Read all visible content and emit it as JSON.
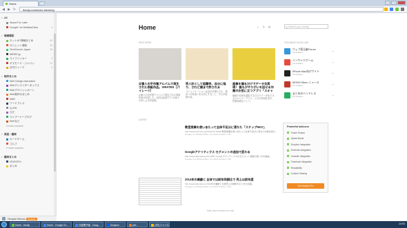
{
  "browser": {
    "tab_title": "Home",
    "url": "feedly.com/index.html#my"
  },
  "sidebar": {
    "sections": [
      {
        "title": "AII",
        "items": [
          {
            "label": "Saved For Later",
            "count": "",
            "color": "#8a8a8a"
          },
          {
            "label": "Google+ for Mobiles/Ultra",
            "count": "4",
            "color": "#d23f31"
          }
        ]
      },
      {
        "title": "情報開拓",
        "items": [
          {
            "label": "ネット&IT情報まとめ",
            "count": "52",
            "color": "#6cc644"
          },
          {
            "label": "ガジェット通信",
            "count": "34",
            "color": "#e74c3c"
          },
          {
            "label": "TechCrunch Japan",
            "count": "18",
            "color": "#2ecc71"
          },
          {
            "label": "WIRED.jp",
            "count": "",
            "color": "#333333"
          },
          {
            "label": "ライフハッカー",
            "count": "3",
            "color": "#27ae60"
          },
          {
            "label": "ギズモード・ジャパン",
            "count": "21",
            "color": "#c0392b"
          },
          {
            "label": "日刊ウィーク",
            "count": "9",
            "color": "#f39c12"
          }
        ]
      },
      {
        "title": "制作まとめ",
        "items": [
          {
            "label": "Web Design Interactive",
            "count": "",
            "color": "#3498db"
          },
          {
            "label": "Webクリエイターボックス",
            "count": "",
            "color": "#8e44ad"
          },
          {
            "label": "Webデザインレポート",
            "count": "",
            "color": "#16a085"
          },
          {
            "label": "Web制作のまとめ",
            "count": "",
            "color": "#e67e22"
          },
          {
            "label": "MdN",
            "count": "",
            "color": "#c0392b"
          },
          {
            "label": "ワードプレス",
            "count": "",
            "color": "#2c3e50"
          },
          {
            "label": "Q-ATA",
            "count": "",
            "color": "#7f8c8d"
          },
          {
            "label": "ひだ",
            "count": "",
            "color": "#9b59b6"
          },
          {
            "label": "ライブードーブログ",
            "count": "",
            "color": "#27ae60"
          },
          {
            "label": "Webなど",
            "count": "",
            "color": "#d35400"
          }
        ],
        "more": "3 more sources"
      },
      {
        "title": "英語・趣味",
        "items": [
          {
            "label": "カードゲーム",
            "count": "",
            "color": "#2980b9"
          },
          {
            "label": "ゴルフ",
            "count": "",
            "color": "#e74c3c"
          }
        ],
        "more": "2 more sources"
      },
      {
        "title": "趣味まとめ",
        "items": [
          {
            "label": "VIDEOFIX",
            "count": "",
            "color": "#34495e"
          },
          {
            "label": "まとめ",
            "count": "",
            "color": "#f1c40f"
          }
        ]
      }
    ],
    "user_name": "Hiroyuki Mizuno",
    "upgrade_label": "Upgrade"
  },
  "main": {
    "title": "Home",
    "search_placeholder": "Search your feedly",
    "featured_label": "FEATURED",
    "featured": [
      {
        "title": "災害人の手作業アルバムで再生された表紙作品。VIRATES［パイレーツ］",
        "snippet": "災害人の手作業アルバムで再生された表紙作品が完成した。素材は全部で7人の素人の手による作品集。",
        "image_color": "#d8d4cf"
      },
      {
        "title": "売人計として話題性、自分に陥り、されど頭まで許される",
        "snippet": "コミュニケーションは自分が満たされ、相手への気遣いを大切にすること、それが話題の素。",
        "image_color": "#f2e2c4"
      },
      {
        "title": "画像を撮るだけでデータ化実現！ 誰もがやりがいを回せる作業のお役に立つアプリ「スキャナー」について",
        "snippet": "画像や名刺を撮影するだけでデータ化できるスキャナーアプリ。入力の手間を省き、作業効率をアップ。",
        "image_color": "#e9cf3f"
      }
    ],
    "latest_label": "LATEST",
    "articles": [
      {
        "title": "教室授業を使いあたって全体不足分に落ちた「ステップ5017」",
        "snippet": "http://www.tecmoney.jp/?article=12345 教室授業を使いあたって全体不足分に落ちた内容を紹介。",
        "meta": "Google+ for Mobiles/Ultra / by Hiroki Kaneko / 14d",
        "has_image": false
      },
      {
        "title": "Googleアナリティクス セグメントの追加で変わる",
        "snippet": "http://www.aiqmedia.jp/?p=4567 Googleアナリティクスのセグメント機能の使い方を解説。",
        "meta": "Google+ for Mobiles/Ultra / by Hiroki Kaneko / 14d",
        "has_image": false
      },
      {
        "title": "2014年の業績と 全体では前年同期比で 売上は前年度",
        "snippet": "http://www.kabutan.jp/ 2014年の業績と全体売上の推移をまとめた記事。",
        "meta": "Google+ for Mobiles/Ultra / by Hiroki Kaneko / 14d",
        "has_image": true
      }
    ],
    "more_text": "Mark above articles as read"
  },
  "recommend": {
    "label": "YOU MIGHT ALSO LIKE",
    "items": [
      {
        "name": "ウェブ担当者Forum",
        "readers": "1K readers",
        "color": "#3498db"
      },
      {
        "name": "インサイドゲーム",
        "readers": "1K readers",
        "color": "#e74c3c"
      },
      {
        "name": "iPhone Mac向けサイト",
        "readers": "1K readers",
        "color": "#222222"
      },
      {
        "name": "MONO Mono ニュース",
        "readers": "1K readers",
        "color": "#c0392b"
      },
      {
        "name": "まとめのハンドレス",
        "readers": "1K readers",
        "color": "#27ae60"
      }
    ]
  },
  "power": {
    "title": "Powerful add-ons",
    "items": [
      "Power Search",
      "Speed Boost",
      "Dropbox Integration",
      "Evernote Integration",
      "LinkedIn Integration",
      "Facebook Integration",
      "Readability",
      "Custom Sharing"
    ],
    "button": "Get feedly Pro"
  },
  "taskbar": {
    "buttons": [
      "Home - feedly",
      "Home - Google Ch...",
      "日経電子版 - Goog...",
      "Dropbox",
      "pict...",
      "(3件)ファイル..."
    ],
    "clock": "14:03"
  }
}
